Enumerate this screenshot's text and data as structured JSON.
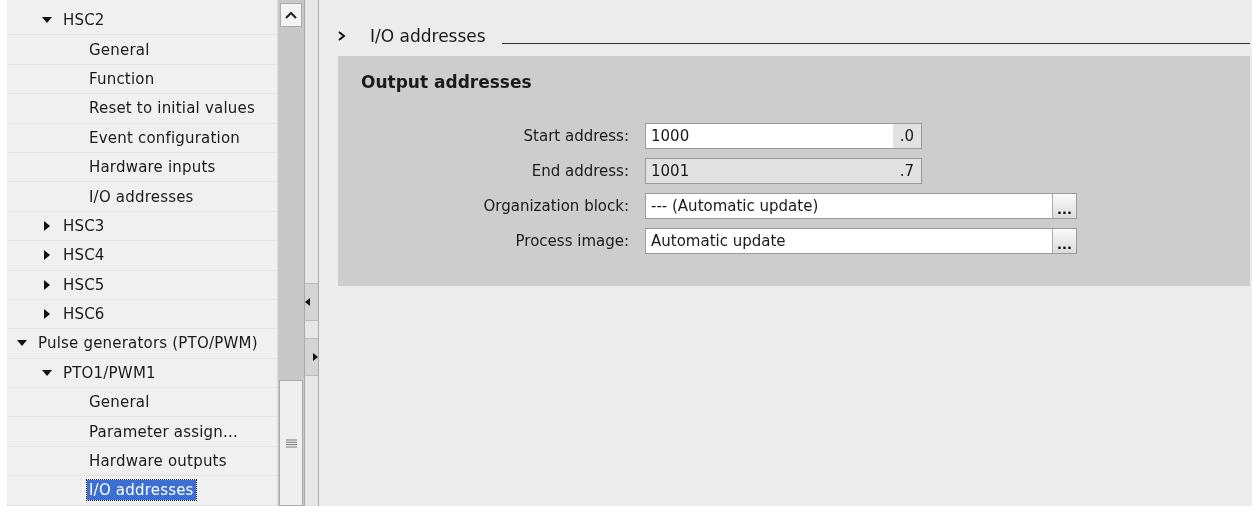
{
  "tree": {
    "continued_items": [
      {
        "label": "HSC2",
        "expanded": true,
        "selected": false,
        "children": [
          {
            "label": "General",
            "selected": false
          },
          {
            "label": "Function",
            "selected": false
          },
          {
            "label": "Reset to initial values",
            "selected": false
          },
          {
            "label": "Event configuration",
            "selected": false
          },
          {
            "label": "Hardware inputs",
            "selected": false
          },
          {
            "label": "I/O addresses",
            "selected": false
          }
        ]
      },
      {
        "label": "HSC3",
        "expanded": false,
        "selected": false
      },
      {
        "label": "HSC4",
        "expanded": false,
        "selected": false
      },
      {
        "label": "HSC5",
        "expanded": false,
        "selected": false
      },
      {
        "label": "HSC6",
        "expanded": false,
        "selected": false
      }
    ],
    "items": [
      {
        "label": "Pulse generators (PTO/PWM)",
        "expanded": true,
        "selected": false,
        "children": [
          {
            "label": "PTO1/PWM1",
            "expanded": true,
            "selected": false,
            "children": [
              {
                "label": "General",
                "selected": false
              },
              {
                "label": "Parameter assign...",
                "selected": false
              },
              {
                "label": "Hardware outputs",
                "selected": false
              },
              {
                "label": "I/O addresses",
                "selected": true
              }
            ]
          }
        ]
      }
    ]
  },
  "section": {
    "title": "I/O addresses",
    "group": {
      "title": "Output addresses",
      "fields": [
        {
          "kind": "bit_address",
          "label": "Start address:",
          "value": "1000",
          "suffix": ".0",
          "disabled": false
        },
        {
          "kind": "bit_address",
          "label": "End address:",
          "value": "1001",
          "suffix": ".7",
          "disabled": true
        },
        {
          "kind": "picker",
          "label": "Organization block:",
          "value": "--- (Automatic update)",
          "button": "..."
        },
        {
          "kind": "picker",
          "label": "Process image:",
          "value": "Automatic update",
          "button": "..."
        }
      ]
    }
  }
}
